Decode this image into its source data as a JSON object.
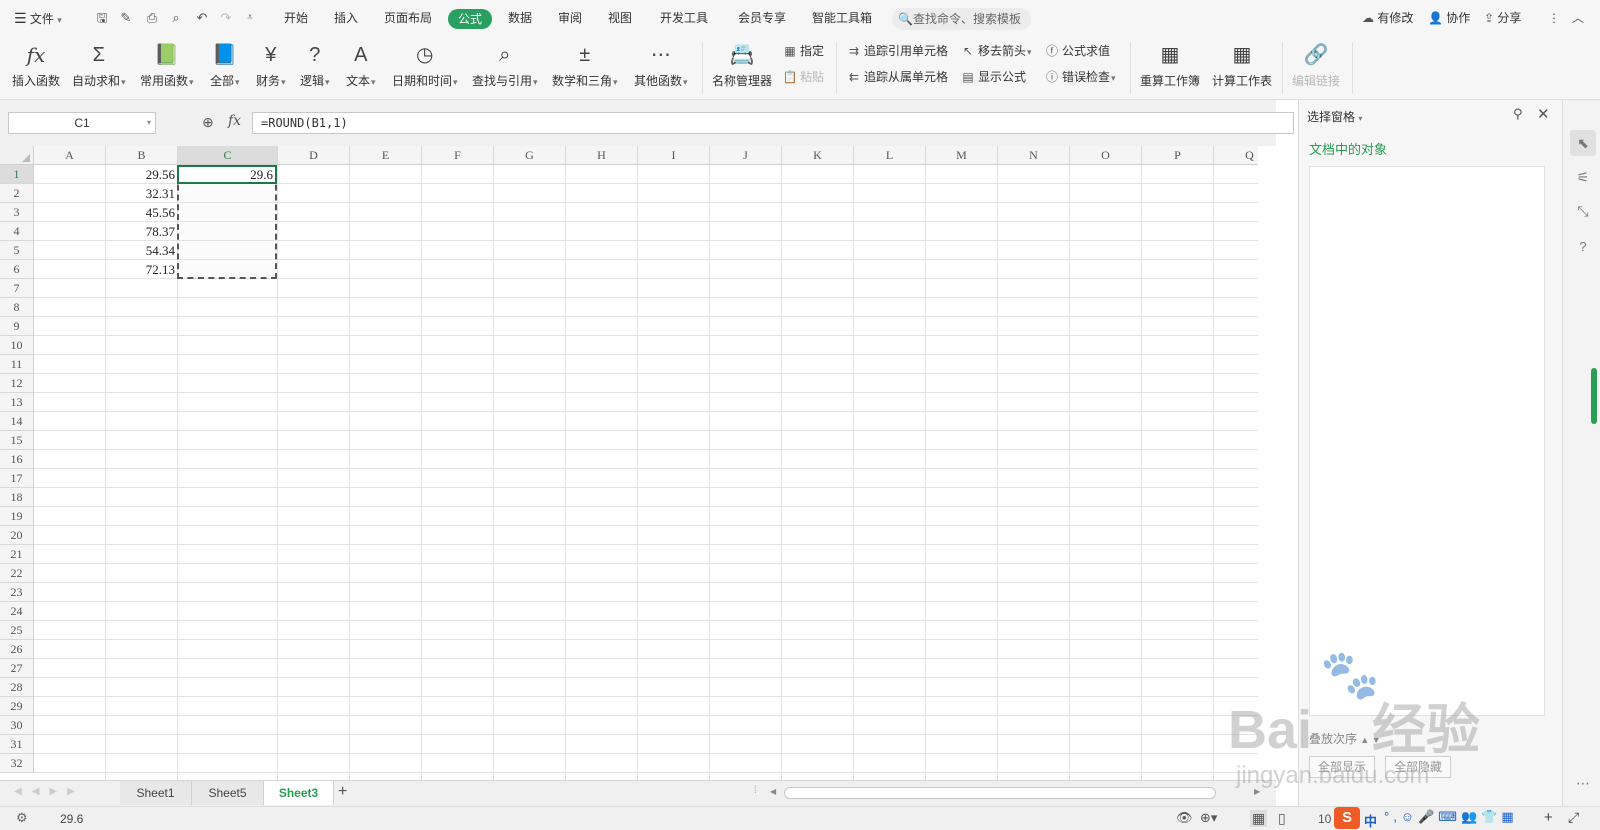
{
  "app": {
    "file_menu": "文件",
    "search_placeholder": "查找命令、搜索模板",
    "has_changes": "有修改",
    "collaborate": "协作",
    "share": "分享"
  },
  "menu_tabs": [
    "开始",
    "插入",
    "页面布局",
    "公式",
    "数据",
    "审阅",
    "视图",
    "开发工具",
    "会员专享",
    "智能工具箱"
  ],
  "active_tab": "公式",
  "ribbon": {
    "insert_function": "插入函数",
    "autosum": "自动求和",
    "common_functions": "常用函数",
    "all": "全部",
    "financial": "财务",
    "logical": "逻辑",
    "text": "文本",
    "datetime": "日期和时间",
    "lookup": "查找与引用",
    "math_trig": "数学和三角",
    "other_functions": "其他函数",
    "name_manager": "名称管理器",
    "define": "指定",
    "paste": "粘贴",
    "trace_precedents": "追踪引用单元格",
    "trace_dependents": "追踪从属单元格",
    "remove_arrows": "移去箭头",
    "show_formulas": "显示公式",
    "evaluate_formula": "公式求值",
    "error_checking": "错误检查",
    "recalc_workbook": "重算工作簿",
    "calc_sheet": "计算工作表",
    "edit_links": "编辑链接"
  },
  "formula_bar": {
    "name_box": "C1",
    "fx": "fx",
    "formula": "=ROUND(B1,1)"
  },
  "columns": [
    "A",
    "B",
    "C",
    "D",
    "E",
    "F",
    "G",
    "H",
    "I",
    "J",
    "K",
    "L",
    "M",
    "N",
    "O",
    "P",
    "Q"
  ],
  "rows": [
    "1",
    "2",
    "3",
    "4",
    "5",
    "6",
    "7",
    "8",
    "9",
    "10",
    "11",
    "12",
    "13",
    "14",
    "15",
    "16",
    "17",
    "18",
    "19",
    "20",
    "21",
    "22",
    "23",
    "24",
    "25",
    "26",
    "27",
    "28",
    "29",
    "30",
    "31",
    "32"
  ],
  "cells": {
    "B1": "29.56",
    "B2": "32.31",
    "B3": "45.56",
    "B4": "78.37",
    "B5": "54.34",
    "B6": "72.13",
    "C1": "29.6"
  },
  "sheets": [
    "Sheet1",
    "Sheet5",
    "Sheet3"
  ],
  "active_sheet": "Sheet3",
  "side_panel": {
    "title": "选择窗格",
    "objects_label": "文档中的对象",
    "display_order": "叠放次序",
    "show_all": "全部显示",
    "hide_all": "全部隐藏"
  },
  "status": {
    "cell_value": "29.6",
    "zoom": "10",
    "ime_lang": "中"
  },
  "watermark": {
    "brand": "Bai",
    "brand2": "经验",
    "url": "jingyan.baidu.com"
  },
  "colors": {
    "accent": "#28a060",
    "selection": "#1e7a45"
  }
}
